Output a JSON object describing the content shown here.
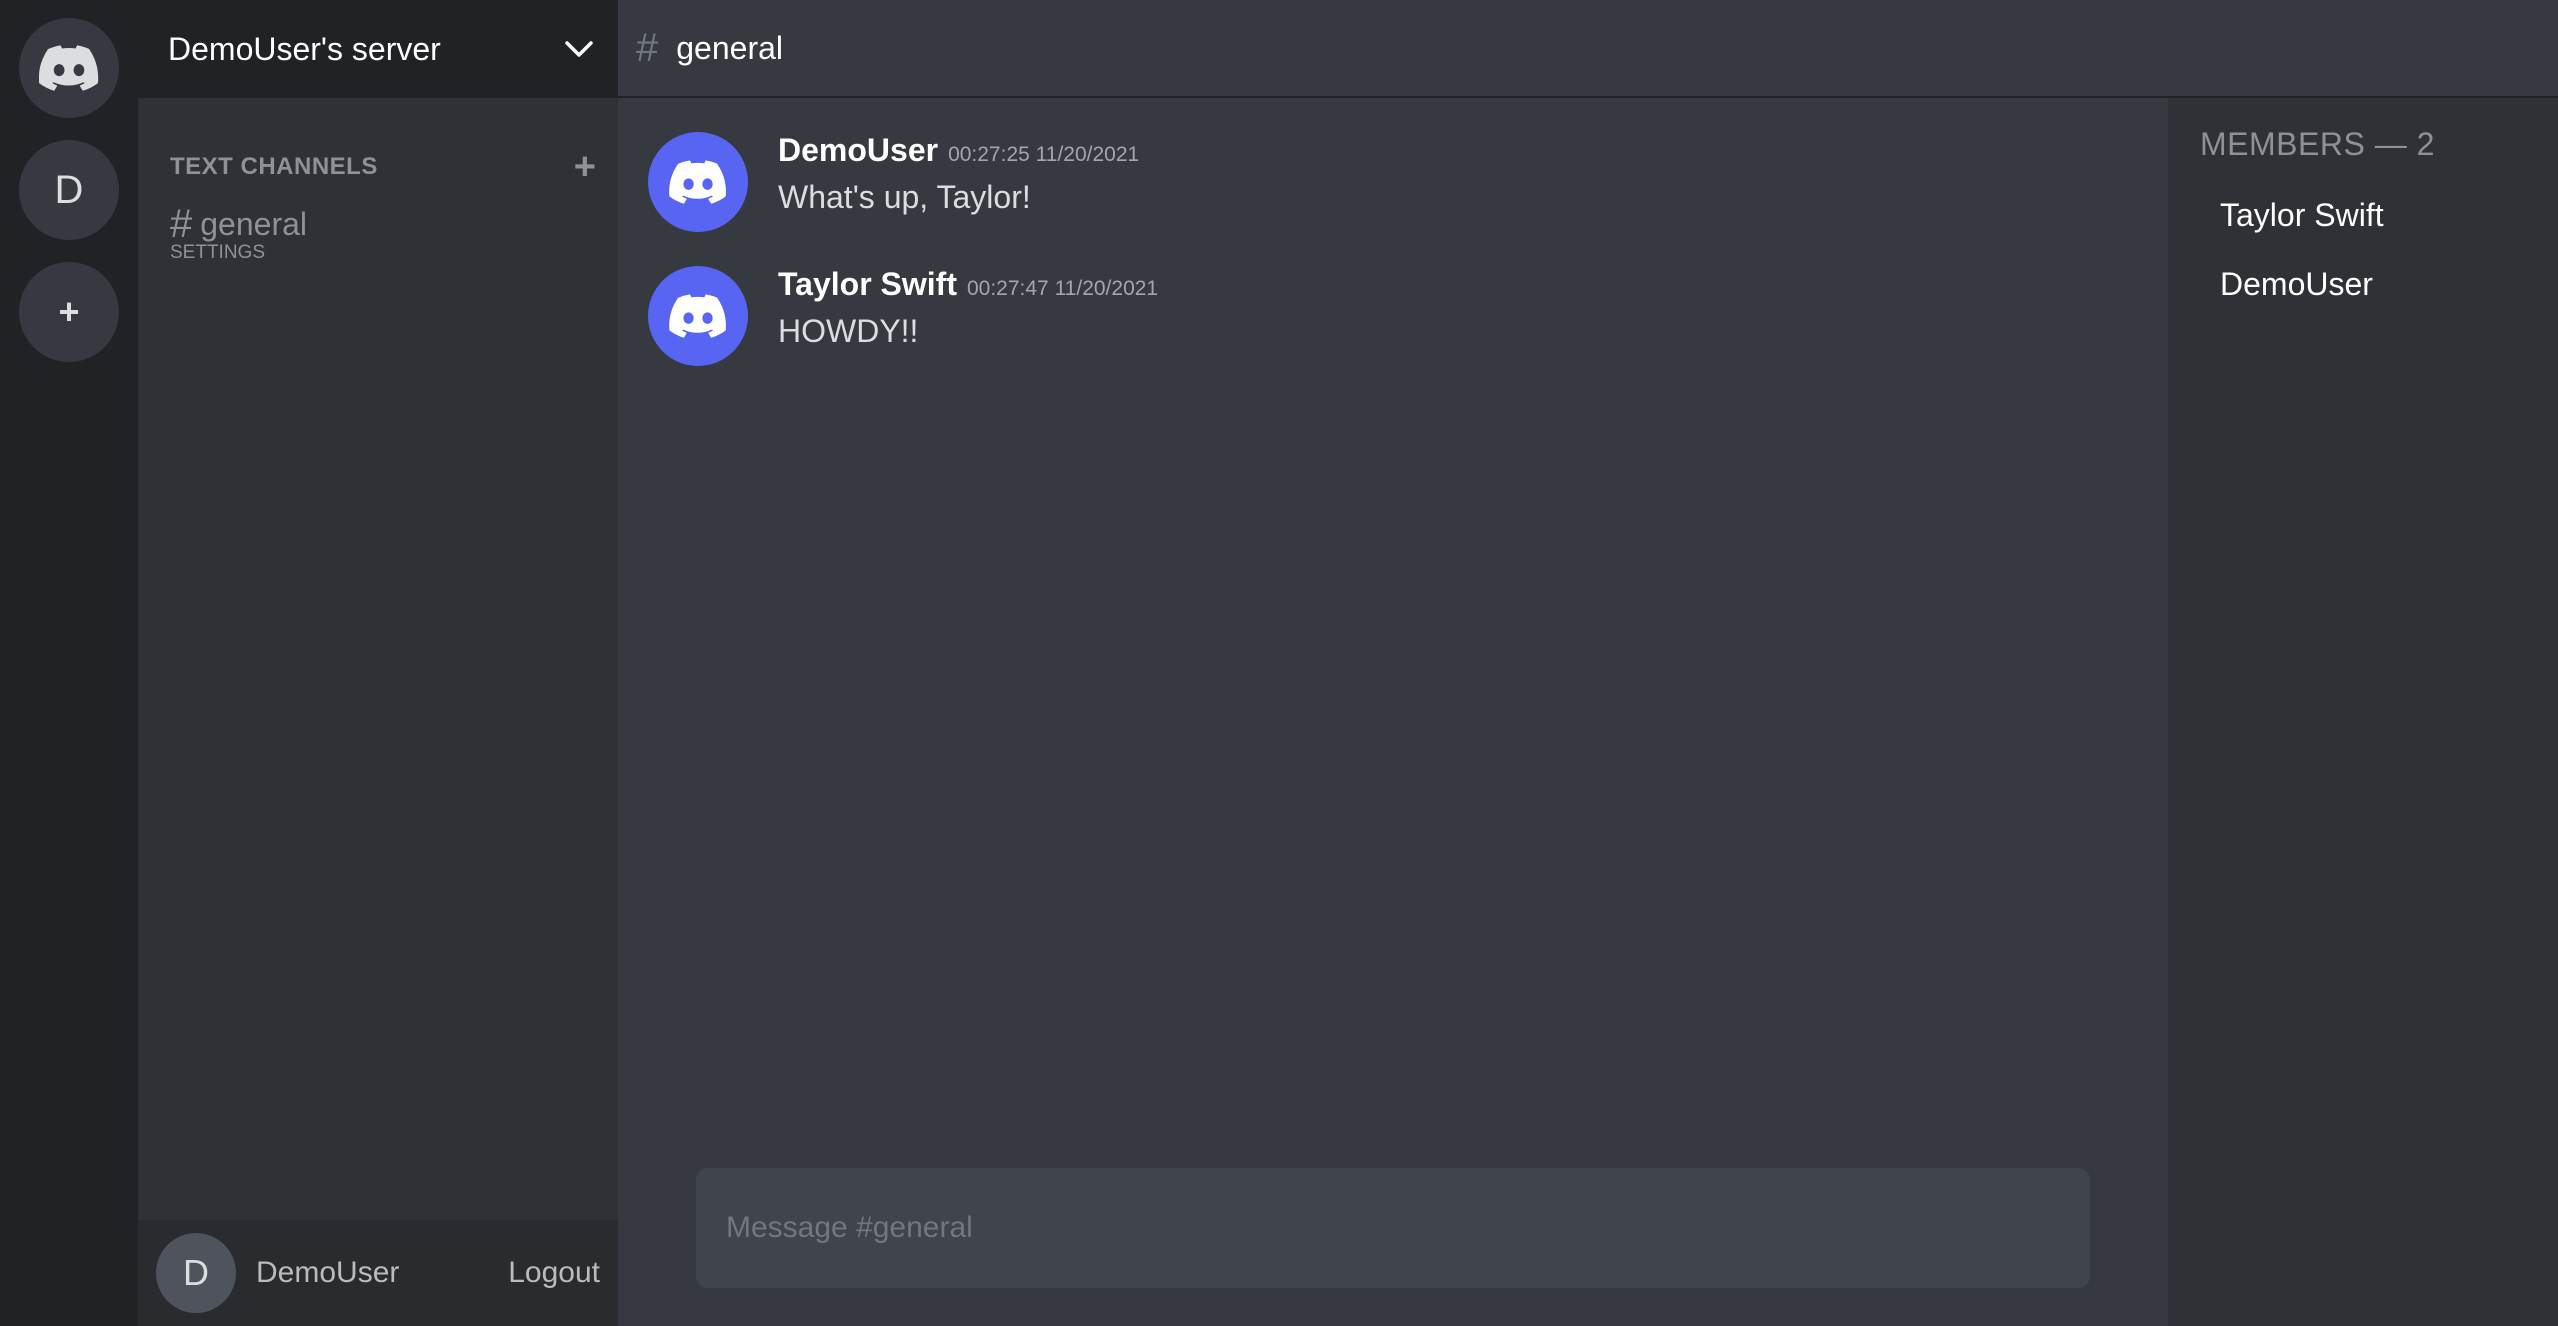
{
  "servers": [
    {
      "type": "home",
      "icon": "discord-logo-icon"
    },
    {
      "type": "server",
      "letter": "D"
    },
    {
      "type": "add",
      "label": "+"
    }
  ],
  "server_header": {
    "name": "DemoUser's server",
    "icon": "chevron-down-icon"
  },
  "channels": {
    "category": "TEXT CHANNELS",
    "add_label": "+",
    "items": [
      {
        "hash": "#",
        "name": "general",
        "settings": "SETTINGS"
      }
    ]
  },
  "user_panel": {
    "avatar_letter": "D",
    "username": "DemoUser",
    "logout": "Logout"
  },
  "channel_header": {
    "hash": "#",
    "title": "general"
  },
  "messages": [
    {
      "author": "DemoUser",
      "time": "00:27:25 11/20/2021",
      "text": "What's up, Taylor!"
    },
    {
      "author": "Taylor Swift",
      "time": "00:27:47 11/20/2021",
      "text": "HOWDY!!"
    }
  ],
  "composer": {
    "placeholder": "Message #general",
    "value": ""
  },
  "members": {
    "header": "MEMBERS — 2",
    "list": [
      "Taylor Swift",
      "DemoUser"
    ]
  },
  "colors": {
    "rail": "#202225",
    "sidebar": "#2f3136",
    "main": "#36393f",
    "blurple": "#5865f2",
    "composer": "#40444b"
  }
}
